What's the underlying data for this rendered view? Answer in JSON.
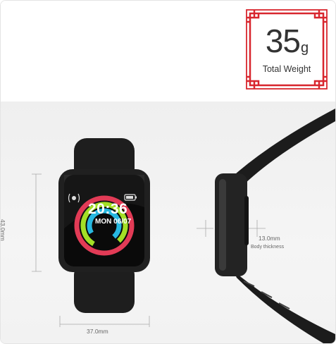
{
  "weight_badge": {
    "value": "35",
    "unit": "g",
    "label": "Total Weight"
  },
  "watch_face": {
    "time": "20:36",
    "date": "MON 06/07"
  },
  "dimensions": {
    "height": "43.0mm",
    "width": "37.0mm",
    "thickness": "13.0mm",
    "thickness_label": "Body thickness"
  },
  "colors": {
    "ring_outer": "#e23b56",
    "ring_mid": "#a3df26",
    "ring_inner": "#27b8e0",
    "seal": "#d8262e",
    "strap": "#1c1c1c"
  }
}
